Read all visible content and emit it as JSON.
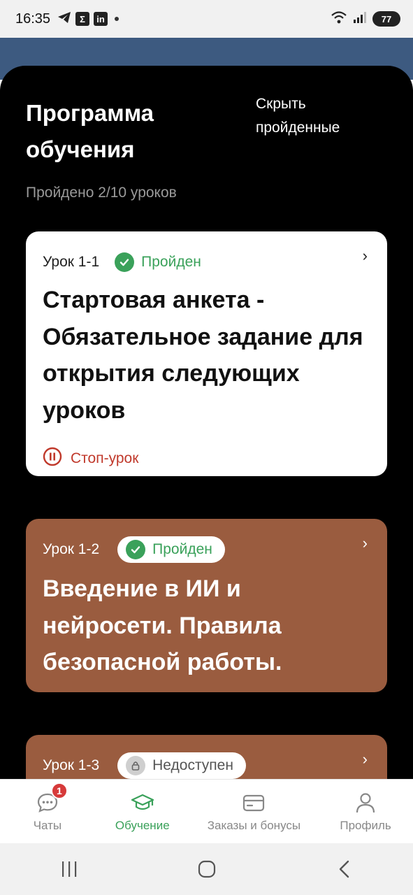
{
  "status_bar": {
    "time": "16:35",
    "battery": "77"
  },
  "header": {
    "title": "Программа обучения",
    "hide_completed": "Скрыть пройденные",
    "progress": "Пройдено 2/10 уроков"
  },
  "lessons": [
    {
      "number": "Урок 1-1",
      "status": "Пройден",
      "title": "Стартовая анкета - Обязательное задание для открытия следующих уроков",
      "flag": "Стоп-урок"
    },
    {
      "number": "Урок 1-2",
      "status": "Пройден",
      "title": "Введение в ИИ и нейросети. Правила безопасной работы."
    },
    {
      "number": "Урок 1-3",
      "status": "Недоступен"
    }
  ],
  "bottom_nav": {
    "items": [
      {
        "label": "Чаты",
        "icon": "chat-icon",
        "badge": "1"
      },
      {
        "label": "Обучение",
        "icon": "graduation-cap-icon",
        "active": true
      },
      {
        "label": "Заказы и бонусы",
        "icon": "card-icon"
      },
      {
        "label": "Профиль",
        "icon": "person-icon"
      }
    ]
  },
  "colors": {
    "accent_green": "#3aa15a",
    "card_brown": "#9a5c3f",
    "header_blue": "#3d5a80",
    "stop_red": "#c0392b"
  }
}
